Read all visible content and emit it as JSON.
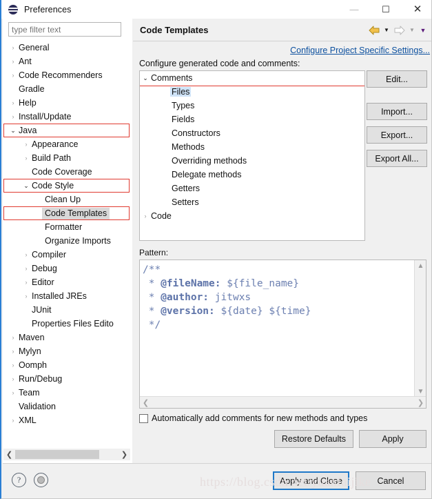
{
  "window": {
    "title": "Preferences",
    "icon": "eclipse-sphere-icon",
    "minimize": "—",
    "maximize": "☐",
    "close": "✕"
  },
  "sidebar": {
    "filter": {
      "placeholder": "type filter text",
      "value": ""
    },
    "items": [
      {
        "label": "General",
        "indent": 0,
        "arrow": "collapsed"
      },
      {
        "label": "Ant",
        "indent": 0,
        "arrow": "collapsed"
      },
      {
        "label": "Code Recommenders",
        "indent": 0,
        "arrow": "collapsed"
      },
      {
        "label": "Gradle",
        "indent": 0,
        "arrow": "none"
      },
      {
        "label": "Help",
        "indent": 0,
        "arrow": "collapsed"
      },
      {
        "label": "Install/Update",
        "indent": 0,
        "arrow": "collapsed"
      },
      {
        "label": "Java",
        "indent": 0,
        "arrow": "expanded",
        "highlight": true
      },
      {
        "label": "Appearance",
        "indent": 1,
        "arrow": "collapsed"
      },
      {
        "label": "Build Path",
        "indent": 1,
        "arrow": "collapsed"
      },
      {
        "label": "Code Coverage",
        "indent": 1,
        "arrow": "none"
      },
      {
        "label": "Code Style",
        "indent": 1,
        "arrow": "expanded",
        "highlight": true
      },
      {
        "label": "Clean Up",
        "indent": 2,
        "arrow": "none"
      },
      {
        "label": "Code Templates",
        "indent": 2,
        "arrow": "none",
        "selected": true,
        "highlight": true
      },
      {
        "label": "Formatter",
        "indent": 2,
        "arrow": "none"
      },
      {
        "label": "Organize Imports",
        "indent": 2,
        "arrow": "none"
      },
      {
        "label": "Compiler",
        "indent": 1,
        "arrow": "collapsed"
      },
      {
        "label": "Debug",
        "indent": 1,
        "arrow": "collapsed"
      },
      {
        "label": "Editor",
        "indent": 1,
        "arrow": "collapsed"
      },
      {
        "label": "Installed JREs",
        "indent": 1,
        "arrow": "collapsed"
      },
      {
        "label": "JUnit",
        "indent": 1,
        "arrow": "none"
      },
      {
        "label": "Properties Files Edito",
        "indent": 1,
        "arrow": "none"
      },
      {
        "label": "Maven",
        "indent": 0,
        "arrow": "collapsed"
      },
      {
        "label": "Mylyn",
        "indent": 0,
        "arrow": "collapsed"
      },
      {
        "label": "Oomph",
        "indent": 0,
        "arrow": "collapsed"
      },
      {
        "label": "Run/Debug",
        "indent": 0,
        "arrow": "collapsed"
      },
      {
        "label": "Team",
        "indent": 0,
        "arrow": "collapsed"
      },
      {
        "label": "Validation",
        "indent": 0,
        "arrow": "none"
      },
      {
        "label": "XML",
        "indent": 0,
        "arrow": "collapsed"
      }
    ]
  },
  "page": {
    "title": "Code Templates",
    "project_link": "Configure Project Specific Settings...",
    "section_label": "Configure generated code and comments:",
    "nav": {
      "back_icon": "back-arrow-icon",
      "forward_icon": "forward-arrow-icon",
      "menu_icon": "dropdown-caret-icon"
    },
    "template_tree": [
      {
        "label": "Comments",
        "type": "group",
        "arrow": "expanded",
        "highlight": true
      },
      {
        "label": "Files",
        "type": "child",
        "selected": true
      },
      {
        "label": "Types",
        "type": "child"
      },
      {
        "label": "Fields",
        "type": "child"
      },
      {
        "label": "Constructors",
        "type": "child"
      },
      {
        "label": "Methods",
        "type": "child"
      },
      {
        "label": "Overriding methods",
        "type": "child"
      },
      {
        "label": "Delegate methods",
        "type": "child"
      },
      {
        "label": "Getters",
        "type": "child"
      },
      {
        "label": "Setters",
        "type": "child"
      },
      {
        "label": "Code",
        "type": "group",
        "arrow": "collapsed"
      }
    ],
    "side_buttons": [
      {
        "label": "Edit..."
      },
      {
        "label": "Import..."
      },
      {
        "label": "Export..."
      },
      {
        "label": "Export All..."
      }
    ],
    "pattern": {
      "label": "Pattern:",
      "lines": [
        {
          "prefix": "/**",
          "tag": "",
          "rest": ""
        },
        {
          "prefix": " * ",
          "tag": "@fileName:",
          "rest": " ${file_name}"
        },
        {
          "prefix": " * ",
          "tag": "@author:",
          "rest": " jitwxs"
        },
        {
          "prefix": " * ",
          "tag": "@version:",
          "rest": " ${date} ${time}"
        },
        {
          "prefix": " */",
          "tag": "",
          "rest": ""
        }
      ]
    },
    "auto_comment_checkbox": {
      "label": "Automatically add comments for new methods and types",
      "checked": false
    },
    "restore_defaults": "Restore Defaults",
    "apply": "Apply"
  },
  "footer": {
    "help_icon": "question-mark-icon",
    "restore_icon": "restore-window-icon",
    "apply_and_close": "Apply and Close",
    "cancel": "Cancel",
    "watermark": "https://blog.csdn.net/yuanfaijike"
  },
  "colors": {
    "highlight_red": "#e03a30",
    "link_blue": "#0b4f9e",
    "selection_blue": "#cfe3f7",
    "default_button_border": "#1e78c8",
    "code_text": "#6b7fb0",
    "accent_left_border": "#2a7fd4"
  }
}
